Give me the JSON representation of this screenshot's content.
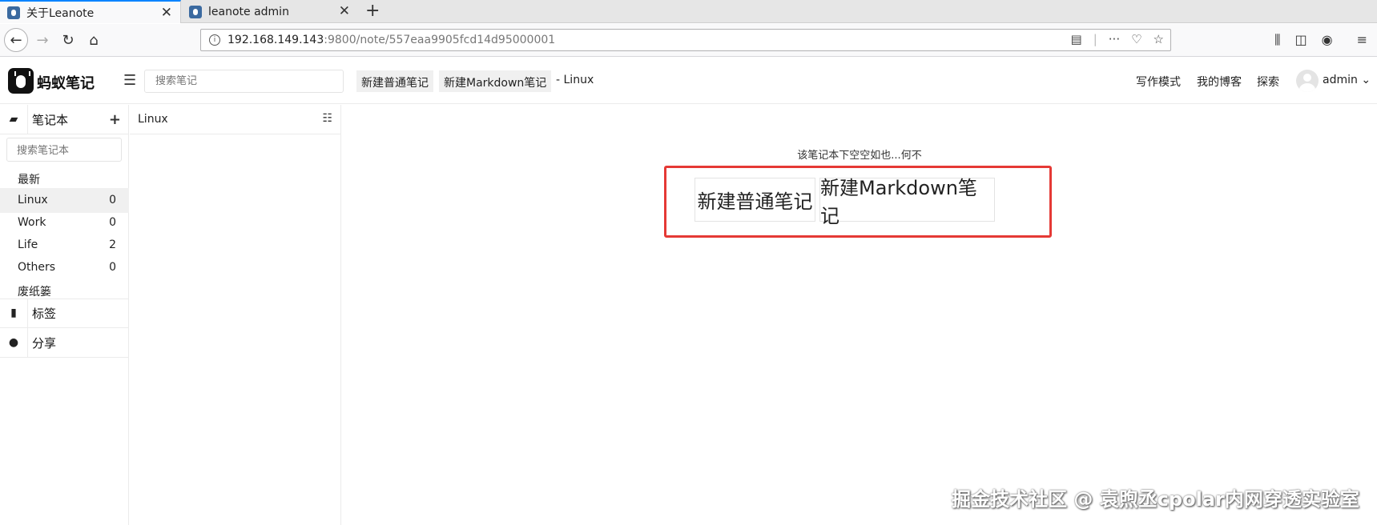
{
  "browser": {
    "tabs": [
      {
        "title": "关于Leanote",
        "active": true
      },
      {
        "title": "leanote admin",
        "active": false
      }
    ],
    "url_host": "192.168.149.143",
    "url_rest": ":9800/note/557eaa9905fcd14d95000001"
  },
  "header": {
    "logo_text": "蚂蚁笔记",
    "search_placeholder": "搜索笔记",
    "new_note_label": "新建普通笔记",
    "new_markdown_label": "新建Markdown笔记",
    "current_notebook": "- Linux",
    "links": [
      "写作模式",
      "我的博客",
      "探索"
    ],
    "username": "admin ⌄"
  },
  "sidebar": {
    "notebooks_label": "笔记本",
    "notebook_search_placeholder": "搜索笔记本",
    "items": [
      {
        "label": "最新",
        "count": ""
      },
      {
        "label": "Linux",
        "count": "0"
      },
      {
        "label": "Work",
        "count": "0"
      },
      {
        "label": "Life",
        "count": "2"
      },
      {
        "label": "Others",
        "count": "0"
      },
      {
        "label": "废纸篓",
        "count": ""
      }
    ],
    "tags_label": "标签",
    "share_label": "分享"
  },
  "notelist": {
    "title": "Linux"
  },
  "main": {
    "empty_message": "该笔记本下空空如也...何不",
    "new_note_button": "新建普通笔记",
    "new_markdown_button": "新建Markdown笔记"
  },
  "watermark": "掘金技术社区 @ 袁煦丞cpolar内网穿透实验室"
}
